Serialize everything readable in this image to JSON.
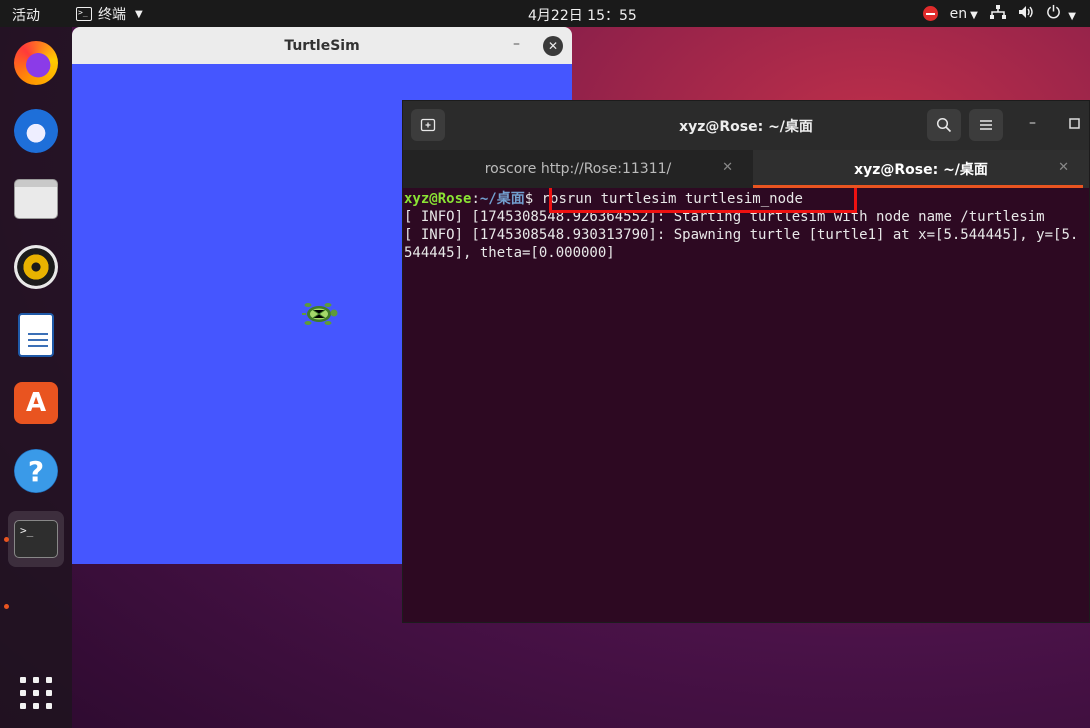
{
  "topbar": {
    "activities": "活动",
    "app_name": "终端",
    "clock": "4月22日  15：55",
    "language": "en"
  },
  "dock": {
    "items": [
      "firefox-icon",
      "thunderbird-icon",
      "files-icon",
      "rhythmbox-icon",
      "libreoffice-writer-icon",
      "software-center-icon",
      "help-icon",
      "terminal-icon"
    ],
    "store_glyph": "A",
    "help_glyph": "?",
    "term_glyph": ">_"
  },
  "turtlesim": {
    "title": "TurtleSim",
    "background": "#4556ff"
  },
  "terminal": {
    "title": "xyz@Rose: ~/桌面",
    "tabs": [
      {
        "label": "roscore http://Rose:11311/"
      },
      {
        "label": "xyz@Rose: ~/桌面"
      }
    ],
    "prompt_user": "xyz@Rose",
    "prompt_colon": ":",
    "prompt_path": "~/桌面",
    "prompt_symbol": "$ ",
    "command": "rosrun turtlesim turtlesim_node",
    "output": [
      "[ INFO] [1745308548.926364552]: Starting turtlesim with node name /turtlesim",
      "[ INFO] [1745308548.930313790]: Spawning turtle [turtle1] at x=[5.544445], y=[5.",
      "544445], theta=[0.000000]"
    ]
  },
  "colors": {
    "accent": "#e95420",
    "highlight": "#ee1111",
    "prompt_user": "#8ae234",
    "prompt_path": "#729fcf"
  }
}
